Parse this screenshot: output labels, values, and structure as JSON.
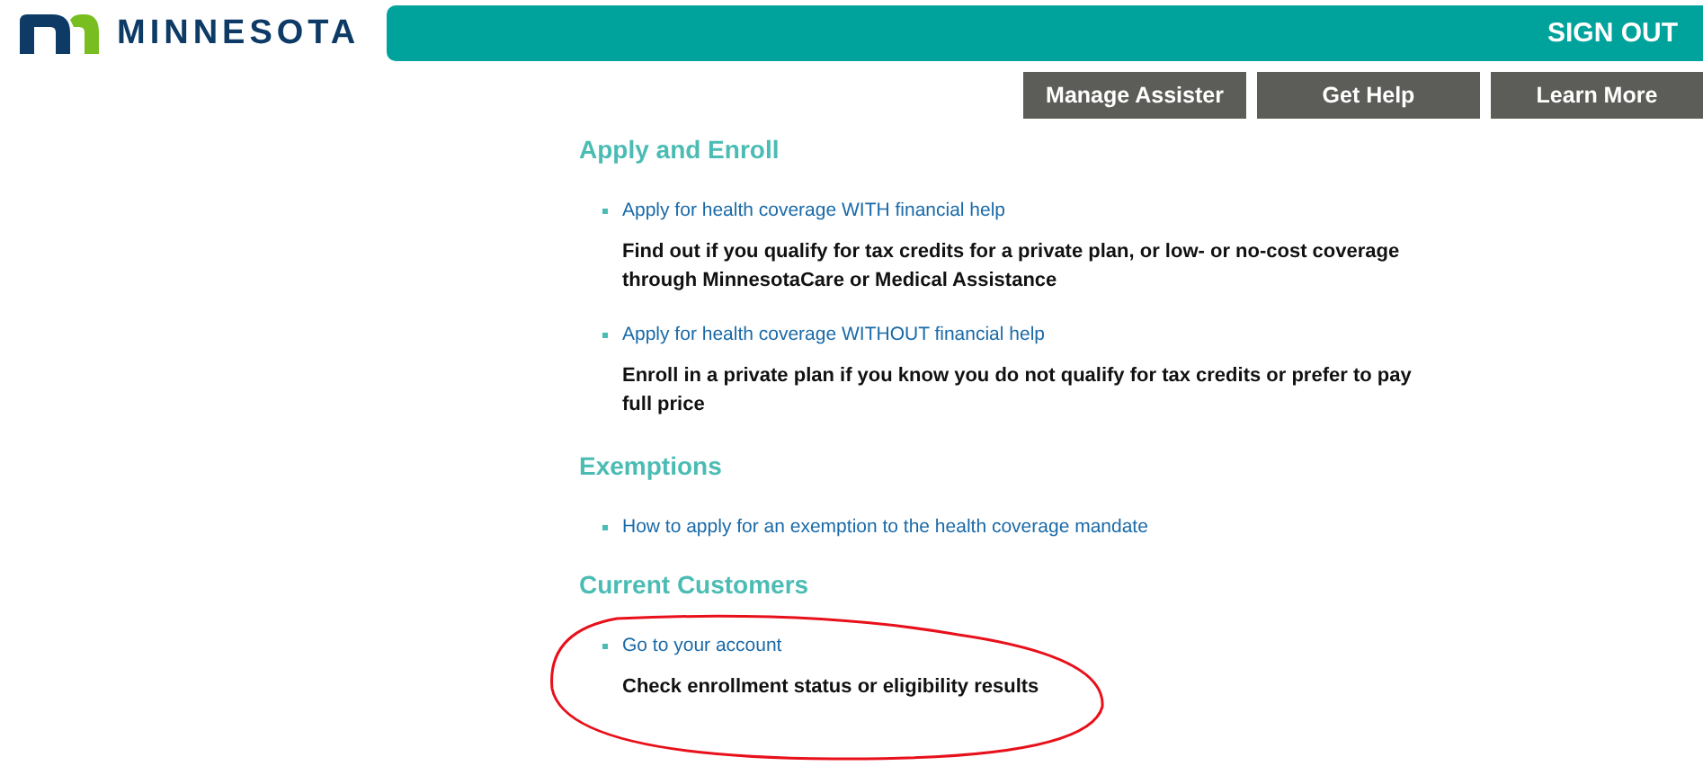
{
  "header": {
    "logo_text": "MINNESOTA",
    "sign_out": "SIGN OUT",
    "buttons": [
      "Manage Assister",
      "Get Help",
      "Learn More"
    ]
  },
  "sections": [
    {
      "title": "Apply and Enroll",
      "items": [
        {
          "link": "Apply for health coverage WITH financial help",
          "description": "Find out if you qualify for tax credits for a private plan, or low- or no-cost coverage through MinnesotaCare or Medical Assistance"
        },
        {
          "link": "Apply for health coverage WITHOUT financial help",
          "description": "Enroll in a private plan if you know you do not qualify for tax credits or prefer to pay full price"
        }
      ]
    },
    {
      "title": "Exemptions",
      "items": [
        {
          "link": "How to apply for an exemption to the health coverage mandate"
        }
      ]
    },
    {
      "title": "Current Customers",
      "items": [
        {
          "link": "Go to your account",
          "description": "Check enrollment status or eligibility results"
        }
      ]
    }
  ]
}
